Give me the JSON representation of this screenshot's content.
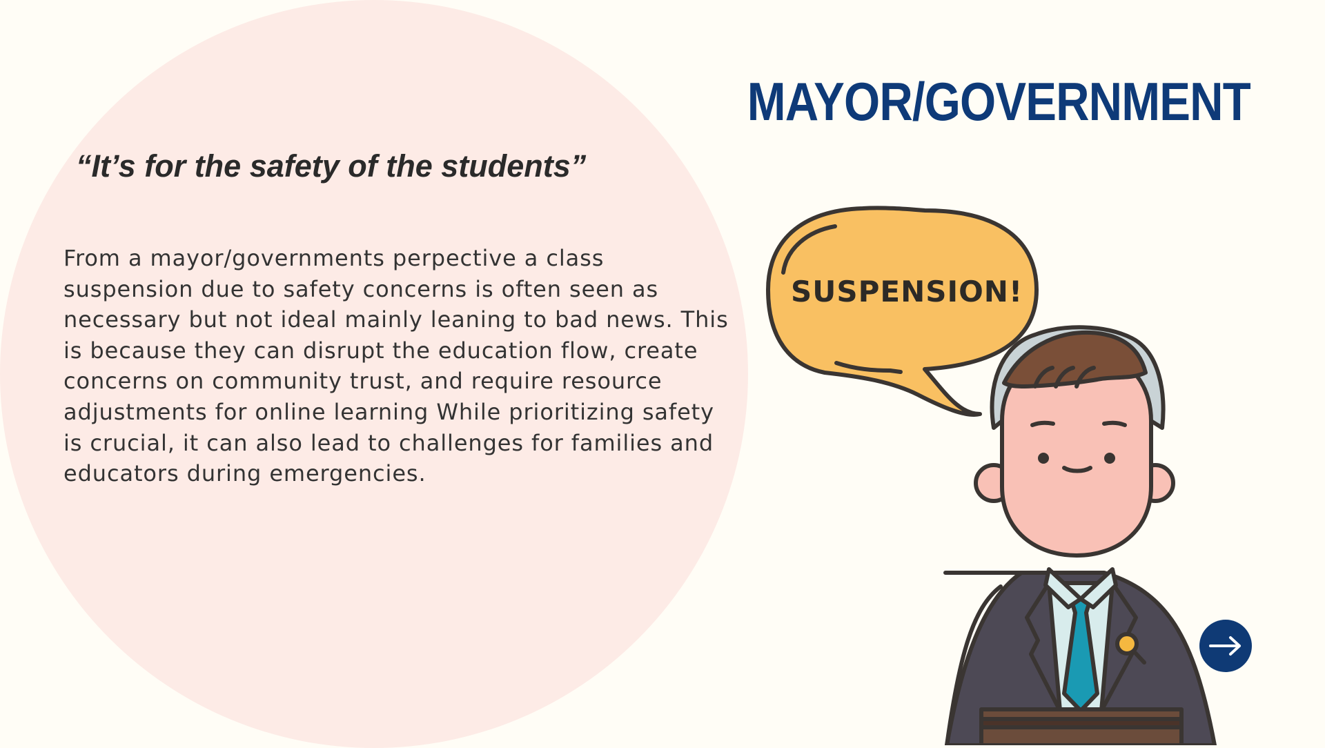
{
  "title": "MAYOR/GOVERNMENT",
  "quote": "“It’s for the safety of the students”",
  "body": "From a mayor/governments perpective a class suspension due to safety concerns is often seen as necessary but not ideal mainly leaning to bad news. This is because they can disrupt the education flow, create concerns on community trust, and require resource adjustments for online learning While prioritizing safety is crucial, it can also lead to challenges for families and educators during emergencies.",
  "speech_bubble": "SUSPENSION!",
  "icons": {
    "next": "arrow-right-icon",
    "illustration": "mayor-at-podium"
  },
  "colors": {
    "background": "#fffdf6",
    "circle": "#fdebe6",
    "title": "#0e3a78",
    "bubble": "#f9c062",
    "button": "#0f3a75"
  }
}
